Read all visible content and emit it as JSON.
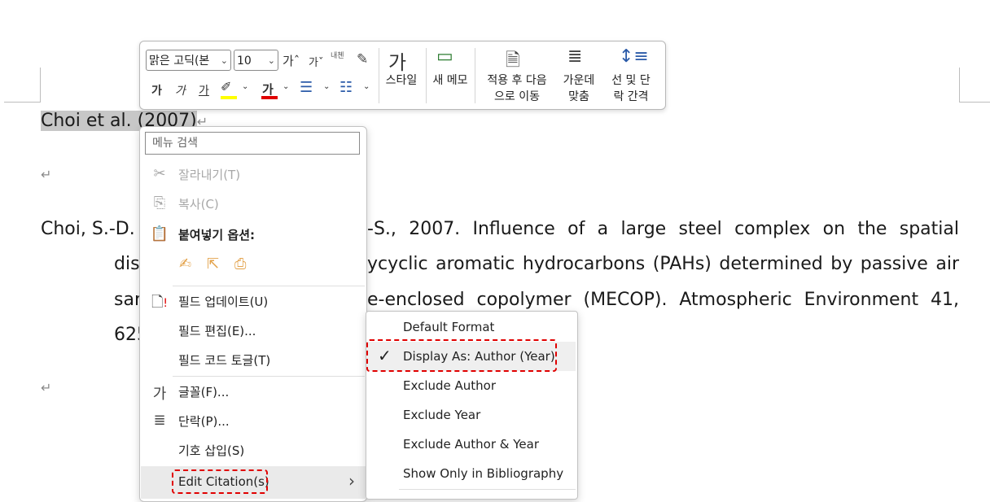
{
  "document": {
    "citation_author": "Choi et al. ",
    "citation_year": "(2007)",
    "pilcrow": "↵",
    "reference": {
      "line1_left": "Choi, S.-D.",
      "line1_right": "-S., 2007. Influence of a large steel complex on the spatial",
      "line2_left": "dis",
      "line2_right": "ycyclic aromatic hydrocarbons (PAHs) determined by passive air",
      "line3_left": "sar",
      "line3_right": "e-enclosed copolymer (MECOP). Atmospheric Environment 41,",
      "line4_left": "625"
    }
  },
  "toolbar": {
    "font_name": "맑은 고딕(본",
    "font_size": "10",
    "grow_font": "가ˆ",
    "shrink_font": "가ˇ",
    "format_painter_label": "내첸",
    "bold": "가",
    "italic": "가",
    "underline": "가",
    "style_label": "스타일",
    "new_memo_label": "새 메모",
    "apply_next_label_1": "적용 후 다음",
    "apply_next_label_2": "으로 이동",
    "center_label_1": "가운데",
    "center_label_2": "맞춤",
    "spacing_label_1": "선 및 단",
    "spacing_label_2": "락 간격",
    "colors": {
      "highlight": "#ffff00",
      "font_color": "#e00000"
    }
  },
  "context_menu": {
    "search_placeholder": "메뉴 검색",
    "items": [
      {
        "label": "잘라내기(T)",
        "icon": "scissors-icon",
        "disabled": true
      },
      {
        "label": "복사(C)",
        "icon": "copy-icon",
        "disabled": true
      },
      {
        "label": "붙여넣기 옵션:",
        "icon": "paste-icon",
        "disabled": false
      },
      {
        "label": "필드 업데이트(U)",
        "icon": "update-field-icon",
        "disabled": false
      },
      {
        "label": "필드 편집(E)...",
        "icon": "",
        "disabled": false
      },
      {
        "label": "필드 코드 토글(T)",
        "icon": "",
        "disabled": false
      },
      {
        "label": "글꼴(F)...",
        "icon": "font-icon",
        "disabled": false
      },
      {
        "label": "단락(P)...",
        "icon": "paragraph-icon",
        "disabled": false
      },
      {
        "label": "기호 삽입(S)",
        "icon": "",
        "disabled": false
      },
      {
        "label": "Edit Citation(s)",
        "icon": "",
        "disabled": false
      }
    ],
    "submenu_arrow": "›"
  },
  "submenu": {
    "items": [
      {
        "label": "Default Format",
        "checked": false
      },
      {
        "label": "Display As: Author (Year)",
        "checked": true
      },
      {
        "label": "Exclude Author",
        "checked": false
      },
      {
        "label": "Exclude Year",
        "checked": false
      },
      {
        "label": "Exclude Author & Year",
        "checked": false
      },
      {
        "label": "Show Only in Bibliography",
        "checked": false
      }
    ],
    "check_glyph": "✓"
  },
  "annotation_color": "#e00000"
}
